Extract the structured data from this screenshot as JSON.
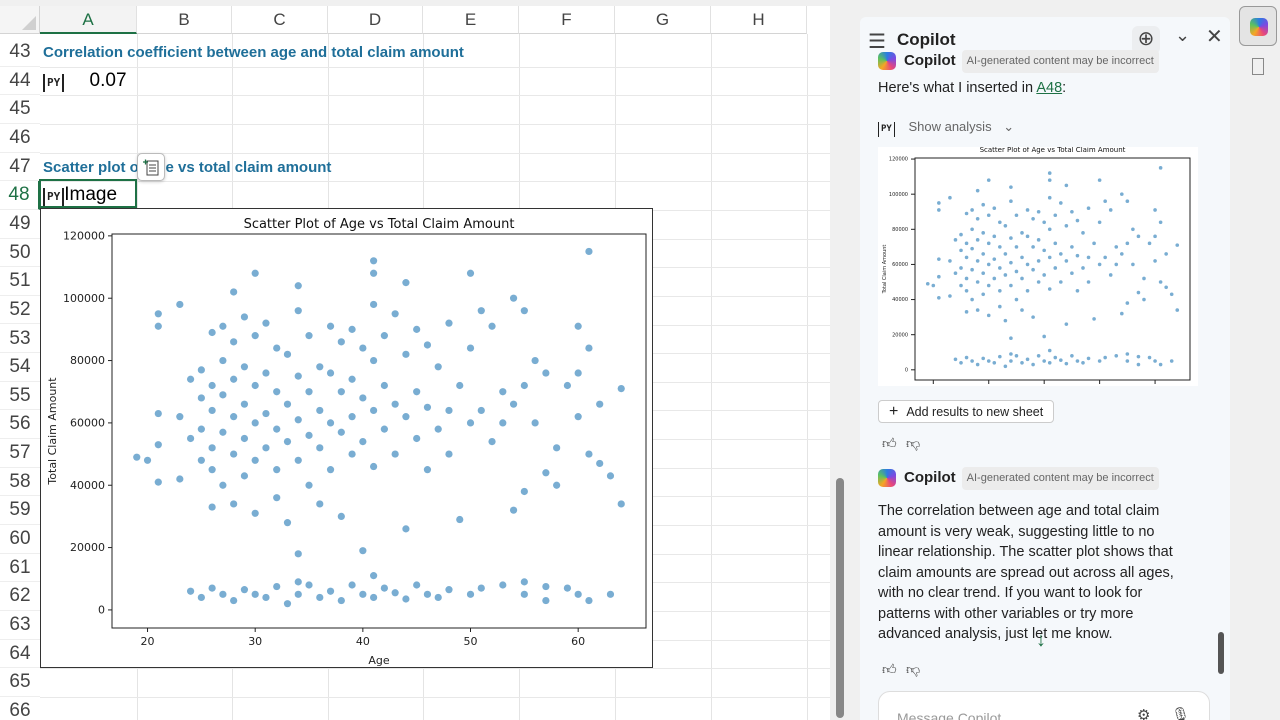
{
  "sheet": {
    "columns": [
      "A",
      "B",
      "C",
      "D",
      "E",
      "F",
      "G",
      "H"
    ],
    "selected_column": "A",
    "rows": [
      "43",
      "44",
      "45",
      "46",
      "47",
      "48",
      "49",
      "50",
      "51",
      "52",
      "53",
      "54",
      "55",
      "56",
      "57",
      "58",
      "59",
      "60",
      "61",
      "62",
      "63",
      "64",
      "65",
      "66"
    ],
    "selected_row": "48",
    "a43": "Correlation coefficient between age and total claim amount",
    "a44_badge": "PY",
    "a44_value": "0.07",
    "a47": "Scatter plot of age vs total claim amount",
    "a48_badge": "PY",
    "a48_value": "Image"
  },
  "chart_data": {
    "type": "scatter",
    "title": "Scatter Plot of Age vs Total Claim Amount",
    "xlabel": "Age",
    "ylabel": "Total Claim Amount",
    "xlim": [
      16.7,
      66.3
    ],
    "ylim": [
      -5800,
      120600
    ],
    "xticks": [
      20,
      30,
      40,
      50,
      60
    ],
    "yticks": [
      0,
      20000,
      40000,
      60000,
      80000,
      100000,
      120000
    ],
    "ytick_labels": [
      "0",
      "20000",
      "40000",
      "60000",
      "80000",
      "100000",
      "120000"
    ],
    "xtick_labels": [
      "20",
      "30",
      "40",
      "50",
      "60"
    ],
    "color": "#1f77b4",
    "points": [
      [
        19,
        49000
      ],
      [
        20,
        48000
      ],
      [
        21,
        95000
      ],
      [
        21,
        91000
      ],
      [
        21,
        63000
      ],
      [
        21,
        53000
      ],
      [
        21,
        41000
      ],
      [
        23,
        98000
      ],
      [
        23,
        62000
      ],
      [
        23,
        42000
      ],
      [
        24,
        74000
      ],
      [
        24,
        55000
      ],
      [
        25,
        77000
      ],
      [
        25,
        68000
      ],
      [
        25,
        58000
      ],
      [
        25,
        48000
      ],
      [
        26,
        89000
      ],
      [
        26,
        72000
      ],
      [
        26,
        64000
      ],
      [
        26,
        52000
      ],
      [
        26,
        45000
      ],
      [
        26,
        33000
      ],
      [
        27,
        91000
      ],
      [
        27,
        80000
      ],
      [
        27,
        69000
      ],
      [
        27,
        57000
      ],
      [
        27,
        40000
      ],
      [
        28,
        102000
      ],
      [
        28,
        86000
      ],
      [
        28,
        74000
      ],
      [
        28,
        62000
      ],
      [
        28,
        50000
      ],
      [
        28,
        34000
      ],
      [
        29,
        94000
      ],
      [
        29,
        78000
      ],
      [
        29,
        66000
      ],
      [
        29,
        55000
      ],
      [
        29,
        43000
      ],
      [
        30,
        108000
      ],
      [
        30,
        88000
      ],
      [
        30,
        72000
      ],
      [
        30,
        60000
      ],
      [
        30,
        48000
      ],
      [
        30,
        31000
      ],
      [
        31,
        92000
      ],
      [
        31,
        76000
      ],
      [
        31,
        63000
      ],
      [
        31,
        52000
      ],
      [
        32,
        84000
      ],
      [
        32,
        70000
      ],
      [
        32,
        58000
      ],
      [
        32,
        45000
      ],
      [
        32,
        36000
      ],
      [
        33,
        82000
      ],
      [
        33,
        66000
      ],
      [
        33,
        54000
      ],
      [
        33,
        28000
      ],
      [
        34,
        104000
      ],
      [
        34,
        96000
      ],
      [
        34,
        75000
      ],
      [
        34,
        61000
      ],
      [
        34,
        48000
      ],
      [
        34,
        18000
      ],
      [
        35,
        88000
      ],
      [
        35,
        70000
      ],
      [
        35,
        56000
      ],
      [
        35,
        40000
      ],
      [
        36,
        78000
      ],
      [
        36,
        64000
      ],
      [
        36,
        52000
      ],
      [
        36,
        34000
      ],
      [
        37,
        91000
      ],
      [
        37,
        76000
      ],
      [
        37,
        60000
      ],
      [
        37,
        45000
      ],
      [
        38,
        86000
      ],
      [
        38,
        70000
      ],
      [
        38,
        57000
      ],
      [
        38,
        30000
      ],
      [
        39,
        90000
      ],
      [
        39,
        74000
      ],
      [
        39,
        62000
      ],
      [
        39,
        50000
      ],
      [
        40,
        84000
      ],
      [
        40,
        68000
      ],
      [
        40,
        54000
      ],
      [
        40,
        19000
      ],
      [
        41,
        112000
      ],
      [
        41,
        108000
      ],
      [
        41,
        98000
      ],
      [
        41,
        80000
      ],
      [
        41,
        64000
      ],
      [
        41,
        46000
      ],
      [
        42,
        88000
      ],
      [
        42,
        72000
      ],
      [
        42,
        58000
      ],
      [
        43,
        95000
      ],
      [
        43,
        66000
      ],
      [
        43,
        50000
      ],
      [
        44,
        105000
      ],
      [
        44,
        82000
      ],
      [
        44,
        62000
      ],
      [
        44,
        26000
      ],
      [
        45,
        90000
      ],
      [
        45,
        70000
      ],
      [
        45,
        55000
      ],
      [
        46,
        85000
      ],
      [
        46,
        65000
      ],
      [
        46,
        45000
      ],
      [
        47,
        78000
      ],
      [
        47,
        58000
      ],
      [
        48,
        92000
      ],
      [
        48,
        64000
      ],
      [
        48,
        50000
      ],
      [
        49,
        72000
      ],
      [
        49,
        29000
      ],
      [
        50,
        108000
      ],
      [
        50,
        84000
      ],
      [
        50,
        60000
      ],
      [
        51,
        96000
      ],
      [
        51,
        64000
      ],
      [
        52,
        91000
      ],
      [
        52,
        54000
      ],
      [
        53,
        70000
      ],
      [
        53,
        60000
      ],
      [
        54,
        100000
      ],
      [
        54,
        66000
      ],
      [
        54,
        32000
      ],
      [
        55,
        96000
      ],
      [
        55,
        72000
      ],
      [
        55,
        38000
      ],
      [
        56,
        80000
      ],
      [
        56,
        60000
      ],
      [
        57,
        76000
      ],
      [
        57,
        44000
      ],
      [
        58,
        52000
      ],
      [
        58,
        40000
      ],
      [
        59,
        72000
      ],
      [
        60,
        91000
      ],
      [
        60,
        76000
      ],
      [
        60,
        62000
      ],
      [
        61,
        115000
      ],
      [
        61,
        84000
      ],
      [
        61,
        50000
      ],
      [
        62,
        66000
      ],
      [
        62,
        47000
      ],
      [
        63,
        43000
      ],
      [
        64,
        71000
      ],
      [
        64,
        34000
      ],
      [
        24,
        6000
      ],
      [
        25,
        4000
      ],
      [
        26,
        7000
      ],
      [
        27,
        5000
      ],
      [
        28,
        3000
      ],
      [
        29,
        6500
      ],
      [
        30,
        5000
      ],
      [
        31,
        4000
      ],
      [
        32,
        7500
      ],
      [
        33,
        2000
      ],
      [
        34,
        9000
      ],
      [
        34,
        5000
      ],
      [
        35,
        8000
      ],
      [
        36,
        4000
      ],
      [
        37,
        6000
      ],
      [
        38,
        3000
      ],
      [
        39,
        8000
      ],
      [
        40,
        5000
      ],
      [
        41,
        11000
      ],
      [
        41,
        4000
      ],
      [
        42,
        7000
      ],
      [
        43,
        5500
      ],
      [
        44,
        3500
      ],
      [
        45,
        8000
      ],
      [
        46,
        5000
      ],
      [
        47,
        4000
      ],
      [
        48,
        6500
      ],
      [
        50,
        5000
      ],
      [
        51,
        7000
      ],
      [
        53,
        8000
      ],
      [
        55,
        9000
      ],
      [
        55,
        5000
      ],
      [
        57,
        7500
      ],
      [
        57,
        3000
      ],
      [
        59,
        7000
      ],
      [
        60,
        5000
      ],
      [
        61,
        3000
      ],
      [
        63,
        5000
      ]
    ]
  },
  "copilot": {
    "title": "Copilot",
    "sender": "Copilot",
    "disclaimer": "AI-generated content may be incorrect",
    "msg1_prefix": "Here's what I inserted in ",
    "msg1_link": "A48",
    "msg1_suffix": ":",
    "py_badge": "PY",
    "show_analysis": "Show analysis",
    "add_results": "Add results to new sheet",
    "msg2": "The correlation between age and total claim amount is very weak, suggesting little to no linear relationship. The scatter plot shows that claim amounts are spread out across all ages, with no clear trend. If you want to look for patterns with other variables or try more advanced analysis, just let me know.",
    "input_placeholder": "Message Copilot"
  }
}
